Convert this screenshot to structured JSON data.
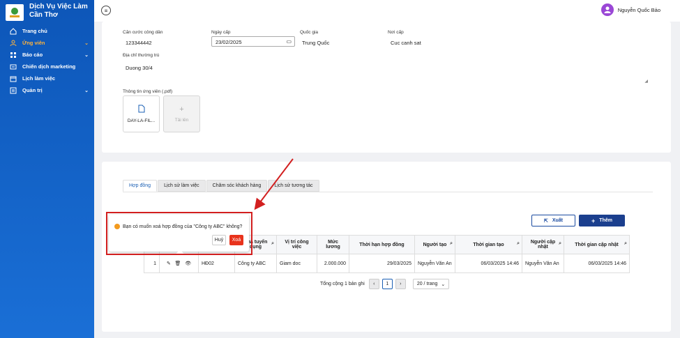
{
  "brand": {
    "line1": "Dịch Vụ Việc Làm",
    "line2": "Cần Thơ"
  },
  "sidebar": {
    "items": [
      {
        "label": "Trang chủ",
        "icon": "home-icon",
        "chevron": false,
        "active": false
      },
      {
        "label": "Ứng viên",
        "icon": "users-icon",
        "chevron": true,
        "active": true
      },
      {
        "label": "Báo cáo",
        "icon": "grid-icon",
        "chevron": true,
        "active": false
      },
      {
        "label": "Chiến dịch marketing",
        "icon": "campaign-icon",
        "chevron": false,
        "active": false
      },
      {
        "label": "Lịch làm việc",
        "icon": "calendar-icon",
        "chevron": false,
        "active": false
      },
      {
        "label": "Quản trị",
        "icon": "admin-icon",
        "chevron": true,
        "active": false
      }
    ],
    "accent": "#ffb33b"
  },
  "user": {
    "name": "Nguyễn Quốc Bảo"
  },
  "form": {
    "cccd_label": "Căn cước công dân",
    "cccd_value": "123344442",
    "ngay_cap_label": "Ngày cấp",
    "ngay_cap_value": "23/02/2025",
    "quoc_gia_label": "Quốc gia",
    "quoc_gia_value": "Trung Quốc",
    "noi_cap_label": "Nơi cấp",
    "noi_cap_value": "Cuc canh sat",
    "dia_chi_label": "Địa chỉ thường trú",
    "dia_chi_value": "Duong 30/4",
    "files_label": "Thông tin ứng viên (.pdf)",
    "file_name": "DAY-LA-FIL...",
    "upload_label": "Tải lên"
  },
  "tabs": [
    {
      "label": "Hợp đồng",
      "active": true
    },
    {
      "label": "Lịch sử làm việc",
      "active": false
    },
    {
      "label": "Chăm sóc khách hàng",
      "active": false
    },
    {
      "label": "Lịch sử tương tác",
      "active": false
    }
  ],
  "actions": {
    "export": "Xuất",
    "add": "Thêm"
  },
  "table": {
    "headers": [
      "",
      "",
      "",
      "Nhà tuyển dụng",
      "Vị trí công việc",
      "Mức lương",
      "Thời hạn hợp đồng",
      "Người tạo",
      "Thời gian tạo",
      "Người cập nhật",
      "Thời gian cập nhật"
    ],
    "row": {
      "stt": "1",
      "code": "HĐ02",
      "employer": "Công ty ABC",
      "position": "Giam doc",
      "salary": "2.000.000",
      "term": "29/03/2025",
      "creator": "Nguyễn Văn An",
      "created_at": "06/03/2025 14:46",
      "updater": "Nguyễn Văn An",
      "updated_at": "06/03/2025 14:46"
    }
  },
  "pager": {
    "total": "Tổng cộng 1 bản ghi",
    "page": "1",
    "size": "20 / trang"
  },
  "popconfirm": {
    "message": "Bạn có muốn xoá hợp đồng của \"Công ty ABC\" không?",
    "cancel": "Huỷ",
    "ok": "Xoá"
  }
}
